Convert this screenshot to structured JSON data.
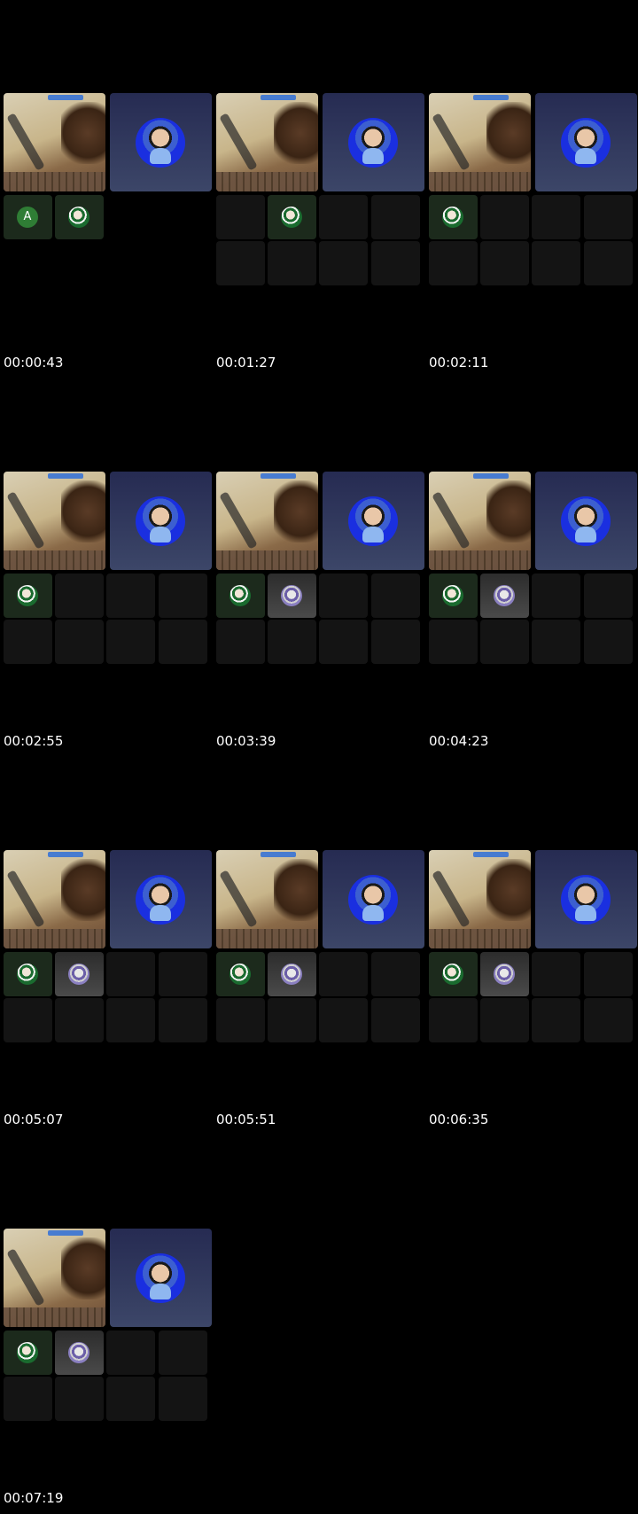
{
  "frames": [
    {
      "timestamp": "00:00:43",
      "layout": "partial",
      "tiles": [
        "letter",
        "p1"
      ],
      "letter": "A"
    },
    {
      "timestamp": "00:01:27",
      "layout": "full",
      "tiles": [
        "empty",
        "p1",
        "empty",
        "empty",
        "empty",
        "empty",
        "empty",
        "empty"
      ]
    },
    {
      "timestamp": "00:02:11",
      "layout": "full",
      "tiles": [
        "p1",
        "empty",
        "empty",
        "empty",
        "empty",
        "empty",
        "empty",
        "empty"
      ]
    },
    {
      "timestamp": "00:02:55",
      "layout": "full",
      "tiles": [
        "p1",
        "empty",
        "empty",
        "empty",
        "empty",
        "empty",
        "empty",
        "empty"
      ]
    },
    {
      "timestamp": "00:03:39",
      "layout": "full",
      "tiles": [
        "p1",
        "p2",
        "empty",
        "empty",
        "empty",
        "empty",
        "empty",
        "empty"
      ]
    },
    {
      "timestamp": "00:04:23",
      "layout": "full",
      "tiles": [
        "p1",
        "p2",
        "empty",
        "empty",
        "empty",
        "empty",
        "empty",
        "empty"
      ]
    },
    {
      "timestamp": "00:05:07",
      "layout": "full",
      "tiles": [
        "p1",
        "p2",
        "empty",
        "empty",
        "empty",
        "empty",
        "empty",
        "empty"
      ]
    },
    {
      "timestamp": "00:05:51",
      "layout": "full",
      "tiles": [
        "p1",
        "p2",
        "empty",
        "empty",
        "empty",
        "empty",
        "empty",
        "empty"
      ]
    },
    {
      "timestamp": "00:06:35",
      "layout": "full",
      "tiles": [
        "p1",
        "p2",
        "empty",
        "empty",
        "empty",
        "empty",
        "empty",
        "empty"
      ]
    },
    {
      "timestamp": "00:07:19",
      "layout": "full",
      "tiles": [
        "p1",
        "p2",
        "empty",
        "empty",
        "empty",
        "empty",
        "empty",
        "empty"
      ]
    }
  ],
  "colors": {
    "background": "#000000",
    "tile_empty": "#141414",
    "host_tile": "#2f3560",
    "avatar_green": "#2f7d35"
  }
}
